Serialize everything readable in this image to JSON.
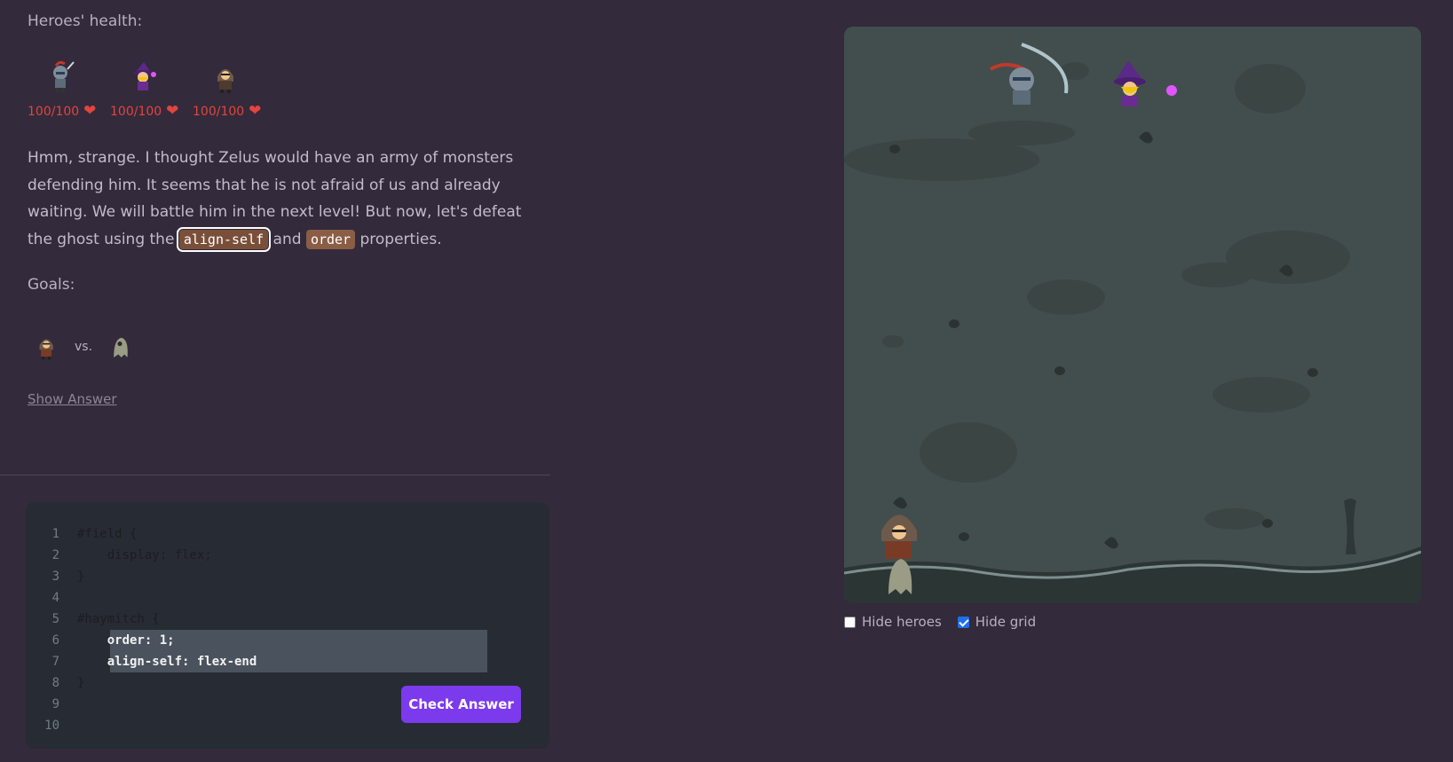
{
  "health": {
    "title": "Heroes' health:",
    "heroes": [
      {
        "name": "knight",
        "hp": "100/100"
      },
      {
        "name": "wizard",
        "hp": "100/100"
      },
      {
        "name": "rogue",
        "hp": "100/100"
      }
    ]
  },
  "story": {
    "part1": "Hmm, strange. I thought Zelus would have an army of monsters defending him. It seems that he is not afraid of us and already waiting. We will battle him in the next level! But now, let's defeat the ghost using the",
    "code1": "align-self",
    "and": "and",
    "code2": "order",
    "part2": "properties."
  },
  "goals": {
    "title": "Goals:",
    "vs": "vs.",
    "show_answer": "Show Answer"
  },
  "editor": {
    "lines": [
      {
        "num": "1",
        "text": "#field {"
      },
      {
        "num": "2",
        "text": "    display: flex;"
      },
      {
        "num": "3",
        "text": "}"
      },
      {
        "num": "4",
        "text": ""
      },
      {
        "num": "5",
        "text": "#haymitch {"
      },
      {
        "num": "6",
        "text": "    order: 1;"
      },
      {
        "num": "7",
        "text": "    align-self: flex-end"
      },
      {
        "num": "8",
        "text": "}"
      },
      {
        "num": "9",
        "text": ""
      },
      {
        "num": "10",
        "text": ""
      }
    ],
    "check_label": "Check Answer"
  },
  "options": {
    "hide_heroes": "Hide heroes",
    "hide_heroes_checked": false,
    "hide_grid": "Hide grid",
    "hide_grid_checked": true
  },
  "colors": {
    "page_bg": "#332a3b",
    "accent_button": "#7c3aed",
    "health_red": "#e2453d",
    "code_tag": "#8a5d45",
    "field_bg": "#424e4d",
    "editor_bg": "#272b33"
  }
}
